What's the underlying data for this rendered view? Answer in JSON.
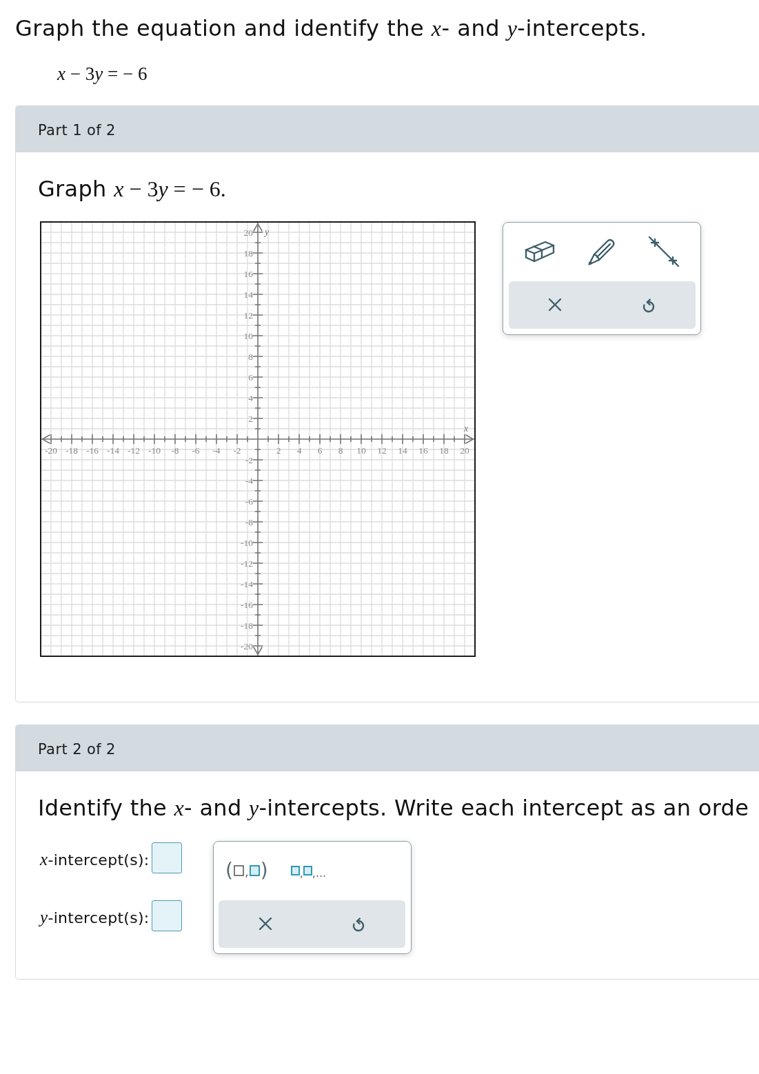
{
  "question": {
    "prompt": "Graph the equation and identify the *x*- and *y*-intercepts.",
    "equation": [
      {
        "kind": "var",
        "text": "x"
      },
      {
        "kind": "sym",
        "text": " − 3"
      },
      {
        "kind": "var",
        "text": "y"
      },
      {
        "kind": "sym",
        "text": " = − 6"
      }
    ]
  },
  "parts": [
    {
      "kind": "graph",
      "header": "Part 1 of 2",
      "instruction": [
        {
          "kind": "text",
          "text": "Graph"
        },
        {
          "kind": "math",
          "tokens": [
            {
              "kind": "var",
              "text": "x"
            },
            {
              "kind": "sym",
              "text": " − 3"
            },
            {
              "kind": "var",
              "text": "y"
            },
            {
              "kind": "sym",
              "text": " = − 6."
            }
          ]
        }
      ],
      "chart_data": {
        "type": "line",
        "grid": true,
        "xlabel": "x",
        "ylabel": "y",
        "xlim": [
          -21,
          21
        ],
        "ylim": [
          -21,
          21
        ],
        "xticks": [
          -20,
          -18,
          -16,
          -14,
          -12,
          -10,
          -8,
          -6,
          -4,
          -2,
          2,
          4,
          6,
          8,
          10,
          12,
          14,
          16,
          18,
          20
        ],
        "yticks": [
          20,
          18,
          16,
          14,
          12,
          10,
          8,
          6,
          4,
          2,
          -2,
          -4,
          -6,
          -8,
          -10,
          -12,
          -14,
          -16,
          -18,
          -20
        ]
      },
      "tools": [
        {
          "kind": "eraser"
        },
        {
          "kind": "pencil"
        },
        {
          "kind": "line"
        }
      ],
      "actions": [
        {
          "kind": "clear"
        },
        {
          "kind": "undo"
        }
      ]
    },
    {
      "kind": "intercepts",
      "header": "Part 2 of 2",
      "instruction": [
        {
          "kind": "text",
          "text": "Identify the *x*- and *y*-intercepts. Write each intercept as an orde"
        }
      ],
      "answers": [
        {
          "label": "*x*-intercept(s):"
        },
        {
          "label": "*y*-intercept(s):"
        }
      ],
      "templates": [
        {
          "kind": "ordered-pair",
          "open": "(",
          "separator": ",",
          "close": ")"
        },
        {
          "kind": "list",
          "separator": ",",
          "tail": ",..."
        }
      ],
      "actions": [
        {
          "kind": "clear"
        },
        {
          "kind": "undo"
        }
      ]
    }
  ]
}
